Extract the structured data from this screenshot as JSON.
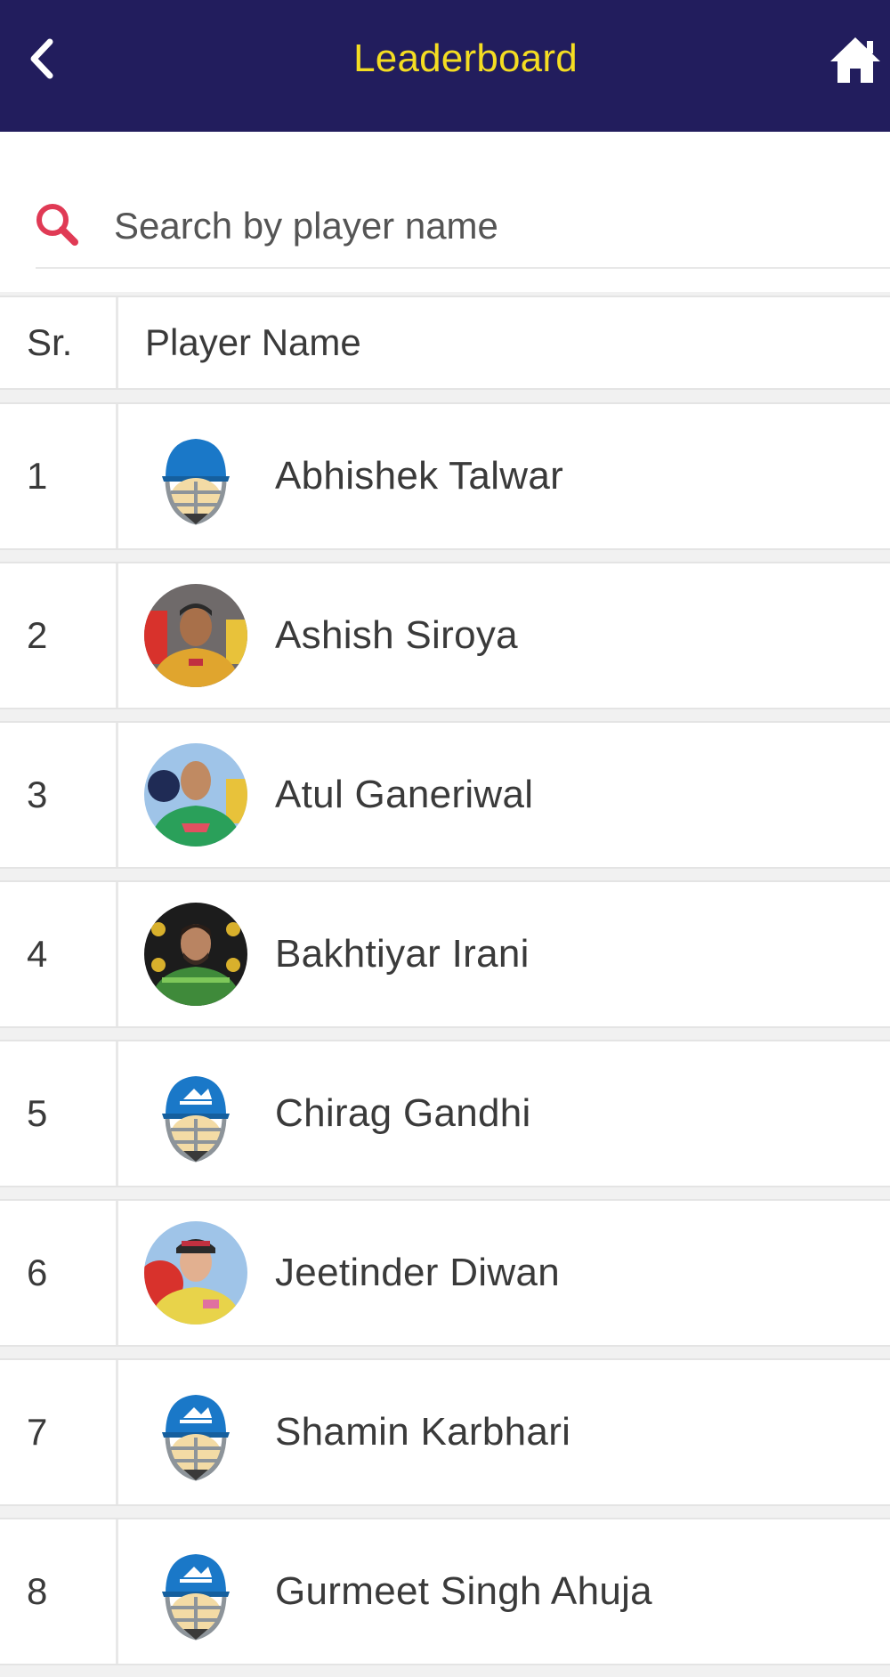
{
  "header": {
    "title": "Leaderboard",
    "back_icon": "chevron-left-icon",
    "home_icon": "home-icon"
  },
  "colors": {
    "header_bg": "#221d5d",
    "title": "#f4dd22",
    "search_icon": "#e03a55",
    "helmet_blue": "#1a78c8"
  },
  "search": {
    "icon": "search-icon",
    "placeholder": "Search by player name",
    "value": ""
  },
  "table": {
    "columns": [
      "Sr.",
      "Player Name"
    ],
    "rows": [
      {
        "sr": "1",
        "name": "Abhishek Talwar",
        "avatar": "helmet-plain"
      },
      {
        "sr": "2",
        "name": "Ashish Siroya",
        "avatar": "photo"
      },
      {
        "sr": "3",
        "name": "Atul Ganeriwal",
        "avatar": "photo"
      },
      {
        "sr": "4",
        "name": "Bakhtiyar Irani",
        "avatar": "photo"
      },
      {
        "sr": "5",
        "name": "Chirag Gandhi",
        "avatar": "helmet-logo"
      },
      {
        "sr": "6",
        "name": "Jeetinder Diwan",
        "avatar": "photo"
      },
      {
        "sr": "7",
        "name": "Shamin Karbhari",
        "avatar": "helmet-logo"
      },
      {
        "sr": "8",
        "name": "Gurmeet Singh Ahuja",
        "avatar": "helmet-logo"
      }
    ]
  }
}
